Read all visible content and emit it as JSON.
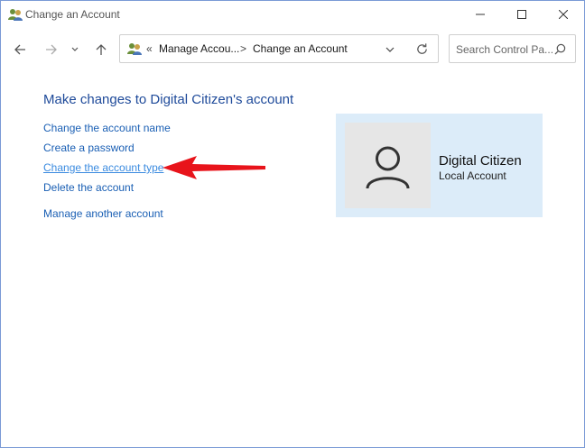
{
  "window": {
    "title": "Change an Account"
  },
  "address_bar": {
    "overflow": "«",
    "crumbs": [
      "Manage Accou...",
      "Change an Account"
    ],
    "separator": ">"
  },
  "search": {
    "placeholder": "Search Control Pa..."
  },
  "main": {
    "heading": "Make changes to Digital Citizen's account",
    "links": [
      "Change the account name",
      "Create a password",
      "Change the account type",
      "Delete the account",
      "Manage another account"
    ]
  },
  "account": {
    "name": "Digital Citizen",
    "type": "Local Account"
  },
  "colors": {
    "link": "#1a5fb4",
    "link_hover": "#3b8be0",
    "heading": "#1e4a9a",
    "card_bg": "#dcecf9",
    "arrow": "#e8141b"
  }
}
